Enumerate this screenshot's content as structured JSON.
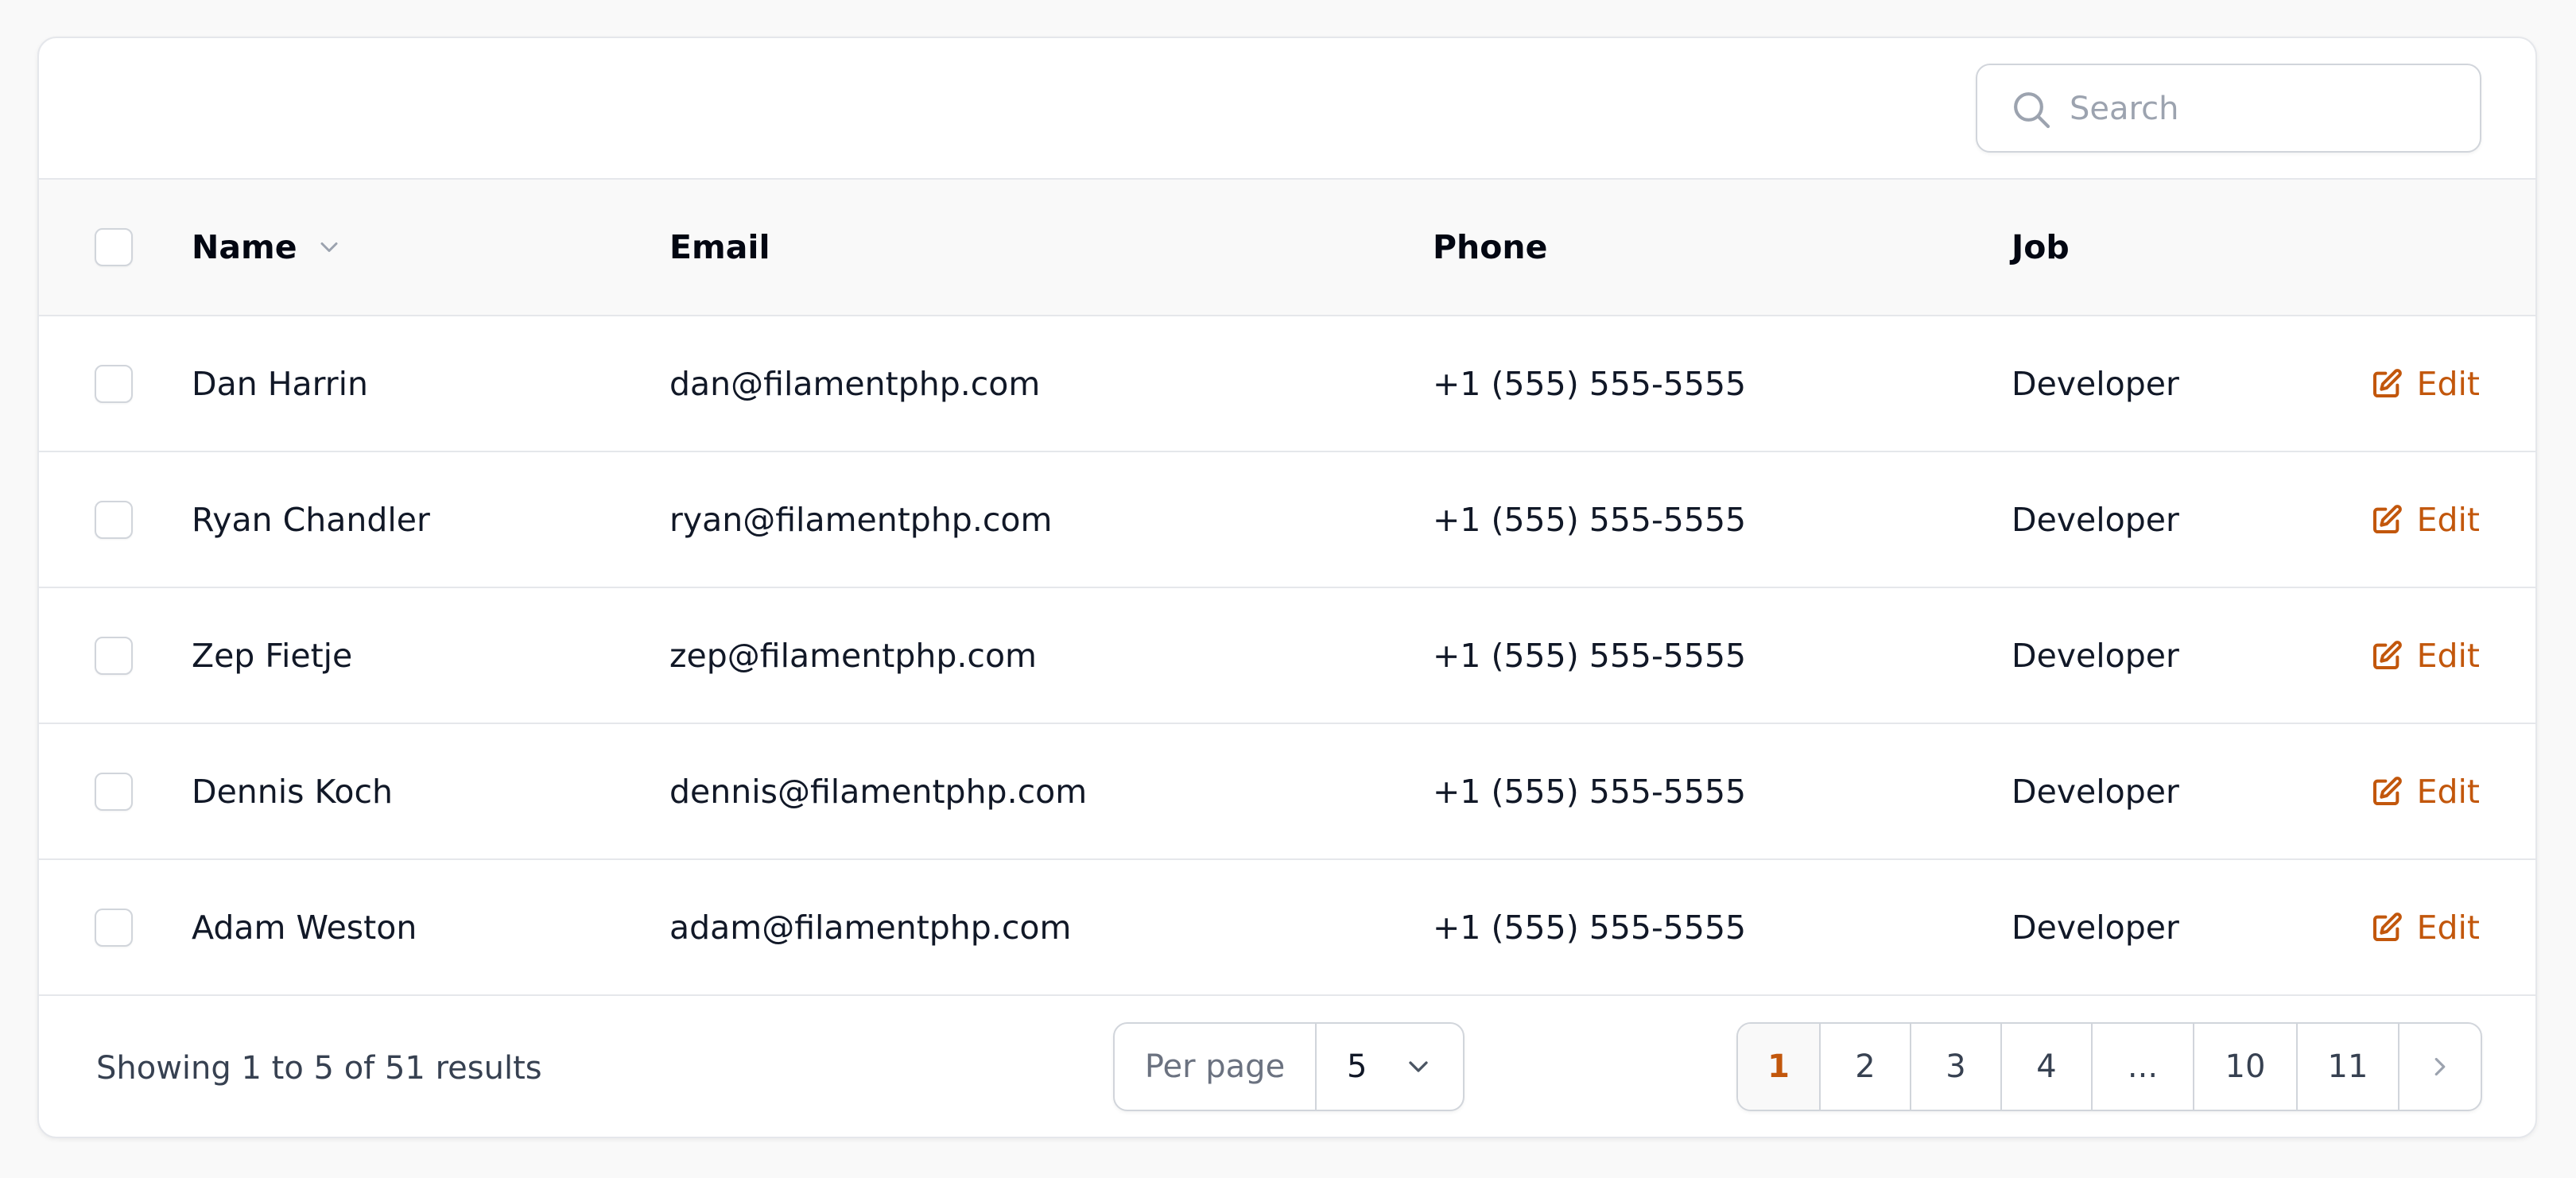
{
  "search": {
    "placeholder": "Search"
  },
  "columns": {
    "name": "Name",
    "email": "Email",
    "phone": "Phone",
    "job": "Job"
  },
  "rows": [
    {
      "name": "Dan Harrin",
      "email": "dan@filamentphp.com",
      "phone": "+1 (555) 555-5555",
      "job": "Developer",
      "action": "Edit"
    },
    {
      "name": "Ryan Chandler",
      "email": "ryan@filamentphp.com",
      "phone": "+1 (555) 555-5555",
      "job": "Developer",
      "action": "Edit"
    },
    {
      "name": "Zep Fietje",
      "email": "zep@filamentphp.com",
      "phone": "+1 (555) 555-5555",
      "job": "Developer",
      "action": "Edit"
    },
    {
      "name": "Dennis Koch",
      "email": "dennis@filamentphp.com",
      "phone": "+1 (555) 555-5555",
      "job": "Developer",
      "action": "Edit"
    },
    {
      "name": "Adam Weston",
      "email": "adam@filamentphp.com",
      "phone": "+1 (555) 555-5555",
      "job": "Developer",
      "action": "Edit"
    }
  ],
  "footer": {
    "results": "Showing 1 to 5 of 51 results",
    "per_page_label": "Per page",
    "per_page_value": "5",
    "pages": [
      "1",
      "2",
      "3",
      "4",
      "...",
      "10",
      "11"
    ],
    "current_page": "1"
  },
  "colors": {
    "accent": "#c2570c",
    "border": "#e5e7eb",
    "header_bg": "#f9f9f9"
  },
  "icons": {
    "search": "search-icon",
    "sort": "chevron-down-icon",
    "edit": "edit-icon",
    "next": "chevron-right-icon"
  }
}
